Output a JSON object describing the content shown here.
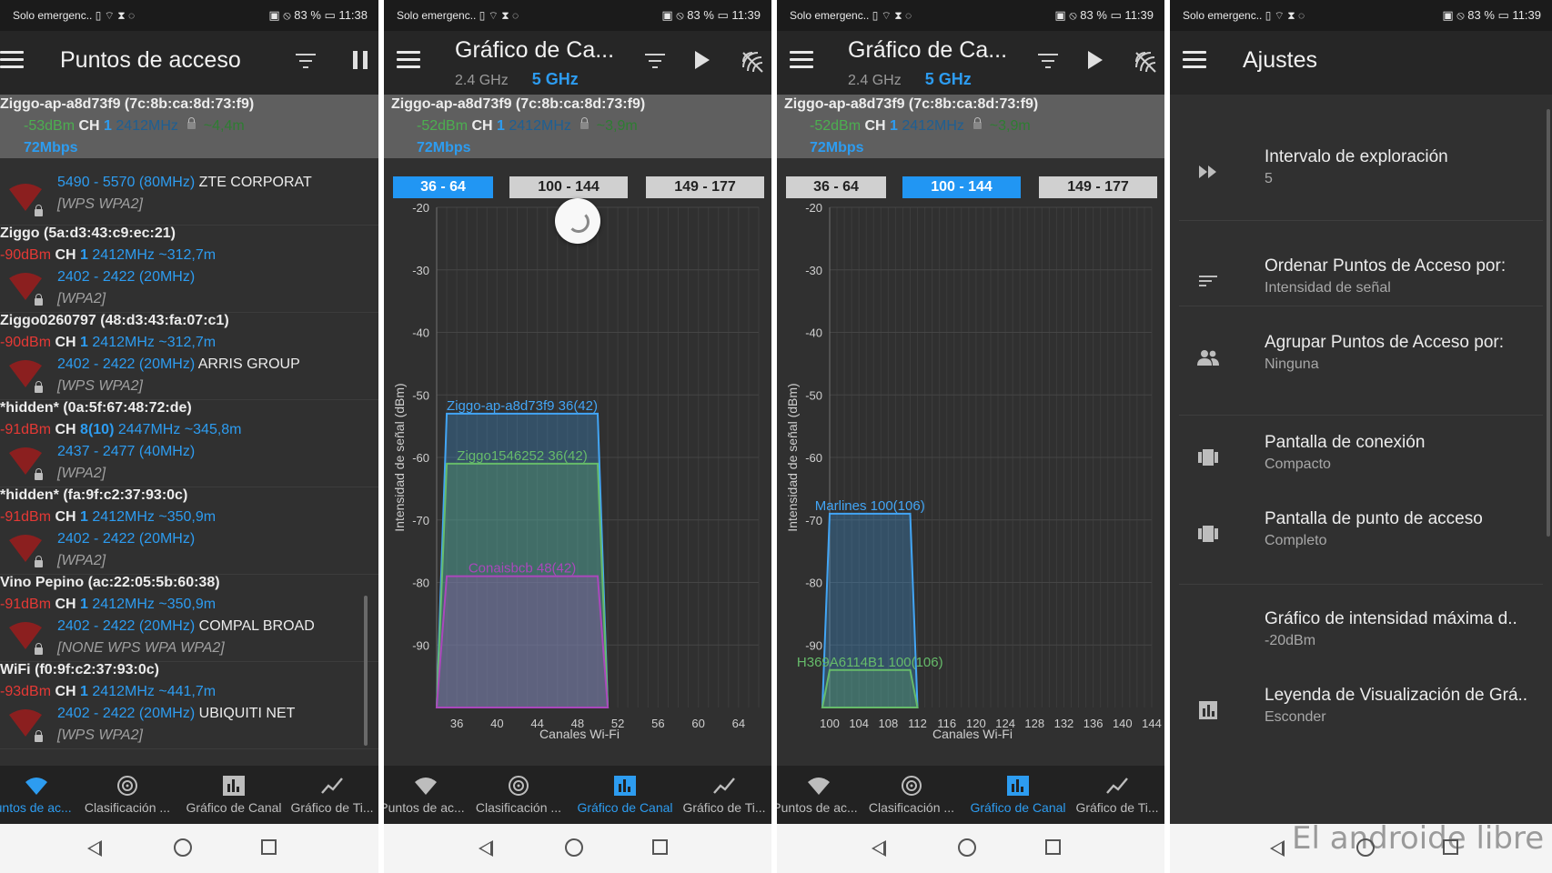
{
  "status": [
    {
      "left": "Solo emergenc.. ▯ ⌔ ⧗ ◌",
      "right": "▣ ⦸ 83 % ▭ 11:38"
    },
    {
      "left": "Solo emergenc.. ▯ ⌔ ⧗ ◌",
      "right": "▣ ⦸ 83 % ▭ 11:39"
    },
    {
      "left": "Solo emergenc.. ▯ ⌔ ⧗ ◌",
      "right": "▣ ⦸ 83 % ▭ 11:39"
    },
    {
      "left": "Solo emergenc.. ▯ ⌔ ⧗ ◌",
      "right": "▣ ⦸ 83 % ▭ 11:39"
    }
  ],
  "titles": {
    "access_points": "Puntos de acceso",
    "channel_graph": "Gráfico de Ca...",
    "settings": "Ajustes",
    "band_24": "2.4 GHz",
    "band_5": "5 GHz"
  },
  "connected": {
    "ssid": "Ziggo-ap-a8d73f9 (7c:8b:ca:8d:73:f9)",
    "p1_dbm": "-53dBm",
    "p2_dbm": "-52dBm",
    "ch_label": "CH",
    "channel": "1",
    "freq": "2412MHz",
    "p1_dist": "~4,4m",
    "p2_dist": "~3,9m",
    "speed": "72Mbps"
  },
  "ap_first": {
    "range": "5490 - 5570 (80MHz)",
    "vendor": "ZTE CORPORAT",
    "security": "[WPS WPA2]"
  },
  "ap_list": [
    {
      "name": "Ziggo (5a:d3:43:c9:ec:21)",
      "dbm": "-90dBm",
      "ch": "1",
      "freq": "2412MHz",
      "dist": "~312,7m",
      "range": "2402 - 2422 (20MHz)",
      "vendor": "",
      "security": "[WPA2]"
    },
    {
      "name": "Ziggo0260797 (48:d3:43:fa:07:c1)",
      "dbm": "-90dBm",
      "ch": "1",
      "freq": "2412MHz",
      "dist": "~312,7m",
      "range": "2402 - 2422 (20MHz)",
      "vendor": "ARRIS GROUP",
      "security": "[WPS WPA2]"
    },
    {
      "name": "*hidden* (0a:5f:67:48:72:de)",
      "dbm": "-91dBm",
      "ch": "8(10)",
      "freq": "2447MHz",
      "dist": "~345,8m",
      "range": "2437 - 2477 (40MHz)",
      "vendor": "",
      "security": "[WPA2]"
    },
    {
      "name": "*hidden* (fa:9f:c2:37:93:0c)",
      "dbm": "-91dBm",
      "ch": "1",
      "freq": "2412MHz",
      "dist": "~350,9m",
      "range": "2402 - 2422 (20MHz)",
      "vendor": "",
      "security": "[WPA2]"
    },
    {
      "name": "Vino Pepino (ac:22:05:5b:60:38)",
      "dbm": "-91dBm",
      "ch": "1",
      "freq": "2412MHz",
      "dist": "~350,9m",
      "range": "2402 - 2422 (20MHz)",
      "vendor": "COMPAL BROAD",
      "security": "[NONE WPS WPA WPA2]"
    },
    {
      "name": "WiFi (f0:9f:c2:37:93:0c)",
      "dbm": "-93dBm",
      "ch": "1",
      "freq": "2412MHz",
      "dist": "~441,7m",
      "range": "2402 - 2422 (20MHz)",
      "vendor": "UBIQUITI NET",
      "security": "[WPS WPA2]"
    }
  ],
  "range_tabs": [
    "36 - 64",
    "100 - 144",
    "149 - 177"
  ],
  "tabs": {
    "ap_full": "Puntos de ac...",
    "rating": "Clasificación ...",
    "channel": "Gráfico de Canal",
    "time": "Gráfico de Ti..."
  },
  "settings": [
    {
      "title": "Intervalo de exploración",
      "value": "5",
      "icon": "fast-forward-icon"
    },
    {
      "title": "Ordenar Puntos de Acceso por:",
      "value": "Intensidad de señal",
      "icon": "sort-icon"
    },
    {
      "title": "Agrupar Puntos de Acceso por:",
      "value": "Ninguna",
      "icon": "group-icon"
    },
    {
      "title": "Pantalla de conexión",
      "value": "Compacto",
      "icon": "view-carousel-icon"
    },
    {
      "title": "Pantalla de punto de acceso",
      "value": "Completo",
      "icon": "view-carousel-icon"
    },
    {
      "title": "Gráfico de intensidad máxima d..",
      "value": "-20dBm",
      "icon": ""
    },
    {
      "title": "Leyenda de Visualización de Grá..",
      "value": "Esconder",
      "icon": "bar-chart-icon"
    }
  ],
  "watermark": "El androide libre",
  "colors": {
    "accent": "#2196f3",
    "green": "#4caf50",
    "red": "#e53935",
    "panel": "#303030"
  },
  "chart_data": [
    {
      "type": "area",
      "ylabel": "Intensidad de señal (dBm)",
      "xlabel": "Canales Wi-Fi",
      "x_ticks": [
        36,
        40,
        44,
        48,
        52,
        56,
        60,
        64
      ],
      "y_ticks": [
        -20,
        -30,
        -40,
        -50,
        -60,
        -70,
        -80,
        -90
      ],
      "xlim": [
        34,
        66
      ],
      "ylim": [
        -100,
        -20
      ],
      "series": [
        {
          "name": "Ziggo-ap-a8d73f9 36(42)",
          "x": [
            34,
            35,
            50,
            51
          ],
          "y": [
            -100,
            -53,
            -53,
            -100
          ],
          "color": "#42a5f5"
        },
        {
          "name": "Ziggo1546252 36(42)",
          "x": [
            34,
            35,
            50,
            51
          ],
          "y": [
            -100,
            -61,
            -61,
            -100
          ],
          "color": "#66bb6a"
        },
        {
          "name": "Conaisbcb 48(42)",
          "x": [
            34,
            35,
            50,
            51
          ],
          "y": [
            -100,
            -79,
            -79,
            -100
          ],
          "color": "#ab47bc"
        }
      ]
    },
    {
      "type": "area",
      "ylabel": "Intensidad de señal (dBm)",
      "xlabel": "Canales Wi-Fi",
      "x_ticks": [
        100,
        104,
        108,
        112,
        116,
        120,
        124,
        128,
        132,
        136,
        140,
        144
      ],
      "y_ticks": [
        -20,
        -30,
        -40,
        -50,
        -60,
        -70,
        -80,
        -90
      ],
      "xlim": [
        100,
        144
      ],
      "ylim": [
        -100,
        -20
      ],
      "series": [
        {
          "name": "Marlines 100(106)",
          "x": [
            99,
            100,
            111,
            112
          ],
          "y": [
            -100,
            -69,
            -69,
            -100
          ],
          "color": "#42a5f5"
        },
        {
          "name": "H369A6114B1 100(106)",
          "x": [
            99,
            100,
            111,
            112
          ],
          "y": [
            -100,
            -94,
            -94,
            -100
          ],
          "color": "#66bb6a"
        }
      ]
    }
  ]
}
